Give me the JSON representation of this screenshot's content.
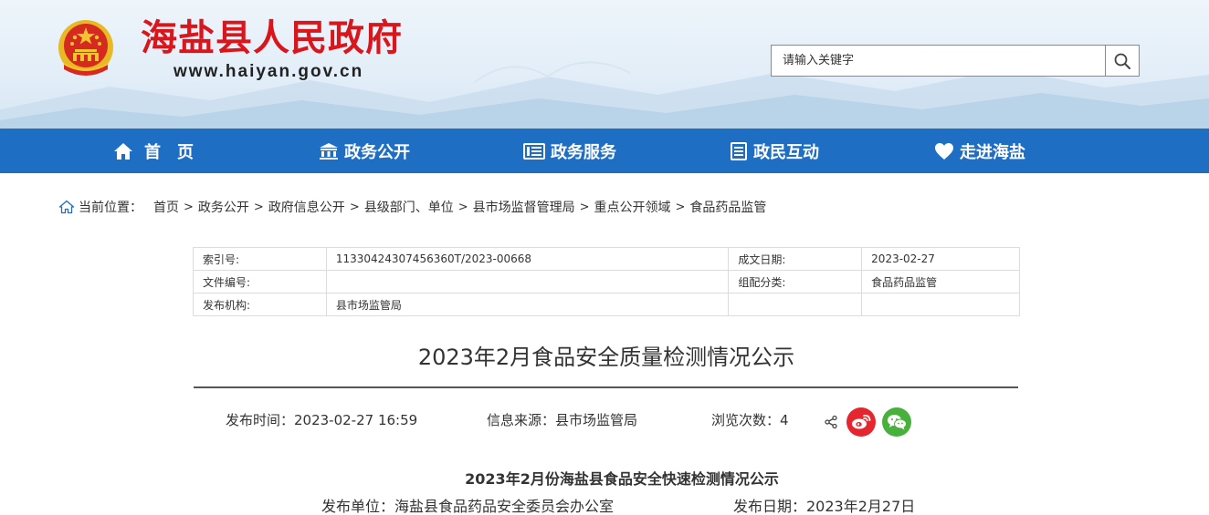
{
  "header": {
    "site_name": "海盐县人民政府",
    "site_url": "www.haiyan.gov.cn",
    "search_placeholder": "请输入关键字"
  },
  "nav": [
    {
      "label": "首　页",
      "icon": "home-icon"
    },
    {
      "label": "政务公开",
      "icon": "government-building-icon"
    },
    {
      "label": "政务服务",
      "icon": "service-list-icon"
    },
    {
      "label": "政民互动",
      "icon": "document-icon"
    },
    {
      "label": "走进海盐",
      "icon": "heart-icon"
    }
  ],
  "breadcrumb": {
    "prefix": "当前位置：",
    "items": [
      "首页",
      "政务公开",
      "政府信息公开",
      "县级部门、单位",
      "县市场监督管理局",
      "重点公开领域",
      "食品药品监管"
    ],
    "separator": ">"
  },
  "meta": {
    "rows": [
      [
        "索引号:",
        "11330424307456360T/2023-00668",
        "成文日期:",
        "2023-02-27"
      ],
      [
        "文件编号:",
        "",
        "组配分类:",
        "食品药品监管"
      ],
      [
        "发布机构:",
        "县市场监管局",
        "",
        ""
      ]
    ]
  },
  "article": {
    "title": "2023年2月食品安全质量检测情况公示",
    "publish_time": "发布时间：2023-02-27 16:59",
    "source": "信息来源：县市场监管局",
    "views": "浏览次数：4",
    "body_heading": "2023年2月份海盐县食品安全快速检测情况公示",
    "issuer": "发布单位：海盐县食品药品安全委员会办公室",
    "issue_date": "发布日期：2023年2月27日"
  },
  "colors": {
    "brand_red": "#d8161c",
    "nav_blue": "#1e6ec4",
    "weibo_red": "#e6262e",
    "wechat_green": "#48b13b"
  }
}
